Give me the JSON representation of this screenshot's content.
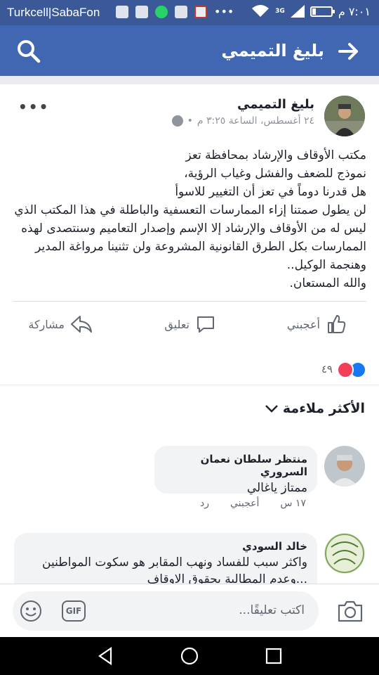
{
  "status_bar": {
    "carrier": "Turkcell|SabaFon",
    "network": "3G",
    "time": "٧:٠١ م",
    "battery_fraction": 0.2
  },
  "header": {
    "title": "بليغ التميمي",
    "search_icon": "search-icon",
    "back_icon": "arrow-right-icon",
    "bg_color": "#4267b2"
  },
  "post": {
    "author": "بليغ التميمي",
    "timestamp": "٢٤ أغسطس، الساعة ٣:٢٥ م",
    "more_label": "•••",
    "lines": [
      "مكتب الأوقاف والإرشاد بمحافظة تعز",
      "نموذج للضعف والفشل وغياب الرؤية،",
      "هل قدرنا دوماً في تعز أن التغيير للاسوأ",
      "لن يطول صمتنا إزاء الممارسات التعسفية والباطلة في هذا المكتب الذي",
      "ليس له من الأوقاف والإرشاد إلا الإسم وإصدار التعاميم وسنتصدى لهذه",
      "الممارسات بكل الطرق القانونية المشروعة ولن تثنينا مرواغة المدير",
      "وهنجمة الوكيل..",
      "والله المستعان."
    ],
    "actions": {
      "like": "أعجبني",
      "comment": "تعليق",
      "share": "مشاركة"
    },
    "reaction_count": "٤٩"
  },
  "comments": {
    "sort_label": "الأكثر ملاءمة",
    "items": [
      {
        "name": "منتظر سلطان نعمان السروري",
        "text": "ممتاز ياغالي",
        "time": "١٧ س",
        "like": "أعجبني",
        "reply": "رد"
      },
      {
        "name": "خالد السودي",
        "text": "واكثر سبب  للفساد ونهب المقابر هو سكوت المواطنين",
        "text2": "...وعدم المطالبة بحقوق الاوقاف"
      }
    ]
  },
  "composer": {
    "placeholder": "اكتب تعليقًا...",
    "gif_label": "GIF"
  }
}
